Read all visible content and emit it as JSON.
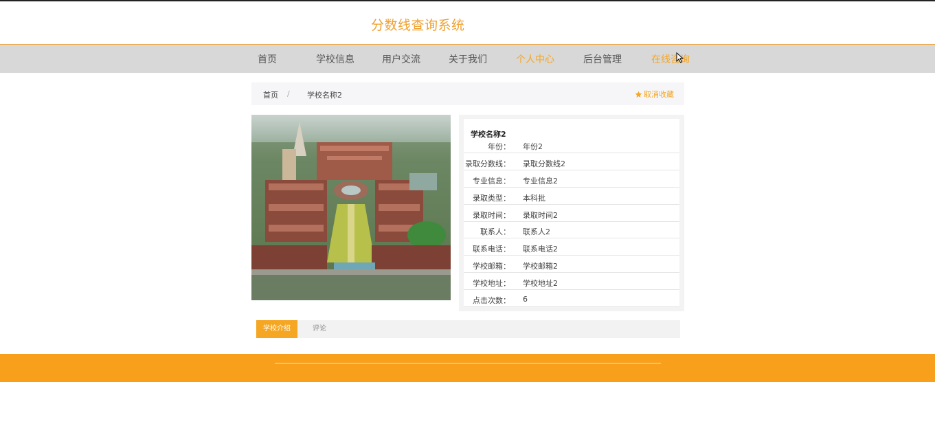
{
  "site": {
    "title": "分数线查询系统"
  },
  "nav": {
    "items": [
      {
        "label": "首页"
      },
      {
        "label": "学校信息"
      },
      {
        "label": "用户交流"
      },
      {
        "label": "关于我们"
      },
      {
        "label": "个人中心",
        "active": true
      },
      {
        "label": "后台管理"
      },
      {
        "label": "在线咨询",
        "active": true
      }
    ]
  },
  "breadcrumb": {
    "home": "首页",
    "separator": "/",
    "current": "学校名称2"
  },
  "favorite": {
    "label": "取消收藏",
    "icon": "star-icon"
  },
  "school": {
    "name": "学校名称2",
    "fields": [
      {
        "label": "年份：",
        "value": "年份2"
      },
      {
        "label": "录取分数线：",
        "value": "录取分数线2"
      },
      {
        "label": "专业信息：",
        "value": "专业信息2"
      },
      {
        "label": "录取类型：",
        "value": "本科批"
      },
      {
        "label": "录取时间：",
        "value": "录取时间2"
      },
      {
        "label": "联系人：",
        "value": "联系人2"
      },
      {
        "label": "联系电话：",
        "value": "联系电话2"
      },
      {
        "label": "学校邮箱：",
        "value": "学校邮箱2"
      },
      {
        "label": "学校地址：",
        "value": "学校地址2"
      },
      {
        "label": "点击次数：",
        "value": "6"
      }
    ]
  },
  "tabs": [
    {
      "label": "学校介绍",
      "active": true
    },
    {
      "label": "评论",
      "active": false
    }
  ],
  "colors": {
    "accent": "#f5a623",
    "navbar": "#d8d8d8",
    "footer": "#f8a01c"
  }
}
